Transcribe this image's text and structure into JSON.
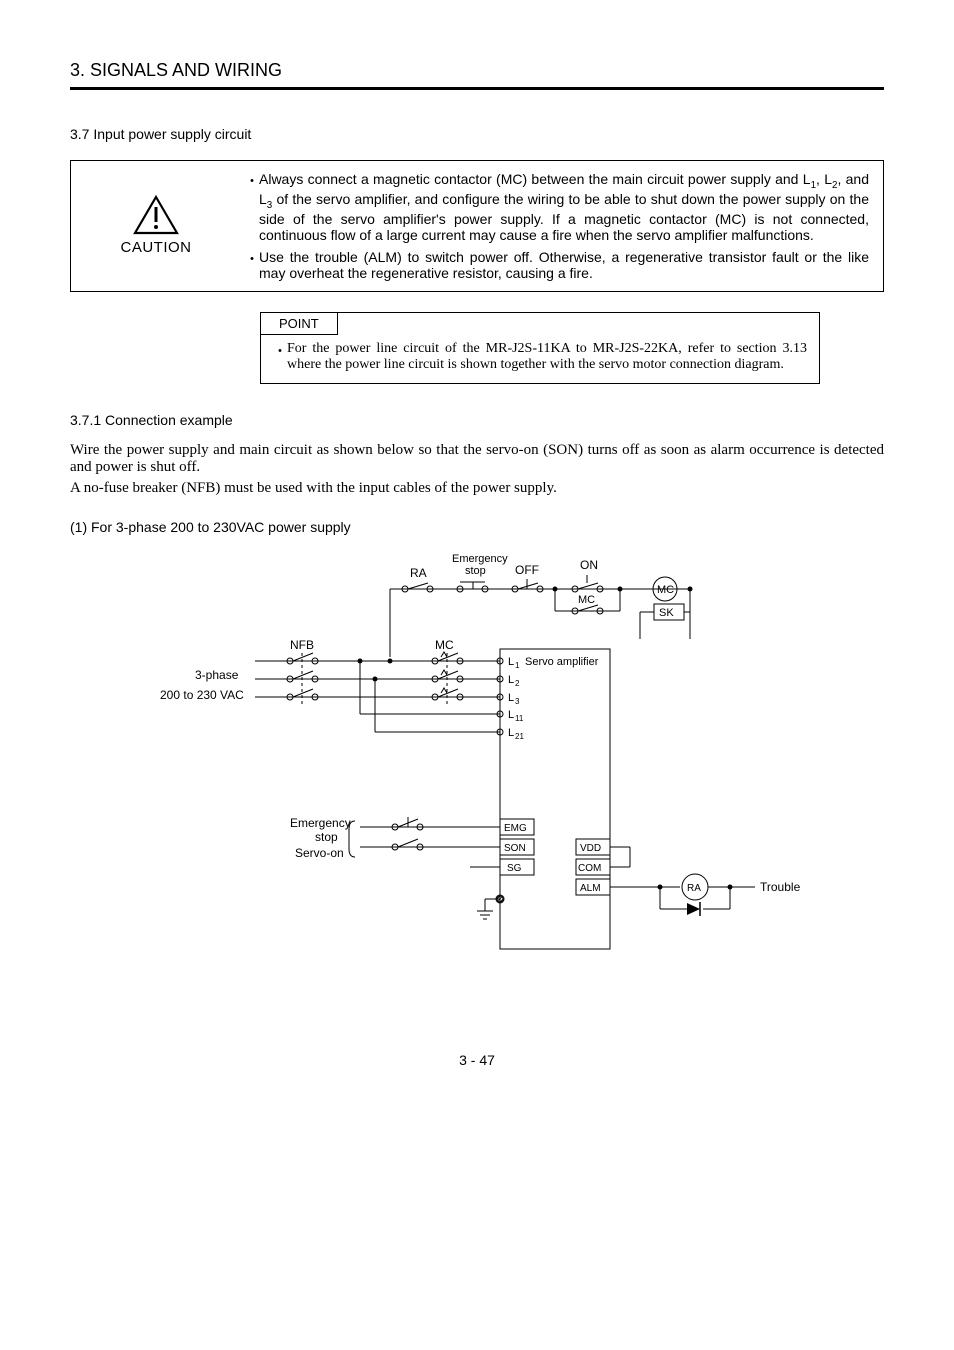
{
  "chapter": "3. SIGNALS AND WIRING",
  "section_num_title": "3.7 Input power supply circuit",
  "caution": {
    "label": "CAUTION",
    "items": [
      "Always connect a magnetic contactor (MC) between the main circuit power supply and L1, L2, and L3 of the servo amplifier, and configure the wiring to be able to shut down the power supply on the side of the servo amplifier's power supply. If a magnetic contactor (MC) is not connected, continuous flow of a large current may cause a fire when the servo amplifier malfunctions.",
      "Use the trouble (ALM) to switch power off. Otherwise, a regenerative transistor fault or the like may overheat the regenerative resistor, causing a fire."
    ]
  },
  "point": {
    "label": "POINT",
    "text": "For the power line circuit of the MR-J2S-11KA to MR-J2S-22KA, refer to section 3.13 where the power line circuit is shown together with the servo motor connection diagram."
  },
  "subsection_title": "3.7.1 Connection example",
  "body_lines": [
    "Wire the power supply and main circuit as shown below so that the servo-on (SON) turns off as soon as alarm occurrence is detected and power is shut off.",
    "A no-fuse breaker (NFB) must be used with the input cables of the power supply."
  ],
  "sub_heading": "(1) For 3-phase 200 to 230VAC power supply",
  "diagram": {
    "labels": {
      "ra": "RA",
      "emergency_stop_top": "Emergency\nstop",
      "off": "OFF",
      "on": "ON",
      "mc_coil": "MC",
      "mc_contact_top": "MC",
      "sk": "SK",
      "nfb": "NFB",
      "mc_main": "MC",
      "three_phase_line1": "3-phase",
      "three_phase_line2": "200 to 230  VAC",
      "servo_amp": "Servo amplifier",
      "l1": "L1",
      "l2": "L2",
      "l3": "L3",
      "l11": "L11",
      "l21": "L21",
      "emg": "EMG",
      "son": "SON",
      "sg": "SG",
      "vdd": "VDD",
      "com": "COM",
      "alm": "ALM",
      "servo_on": "Servo-on",
      "emergency_stop_side": "Emergency\nstop",
      "trouble": "Trouble",
      "ra_circle": "RA"
    }
  },
  "page_number": "3 -  47"
}
